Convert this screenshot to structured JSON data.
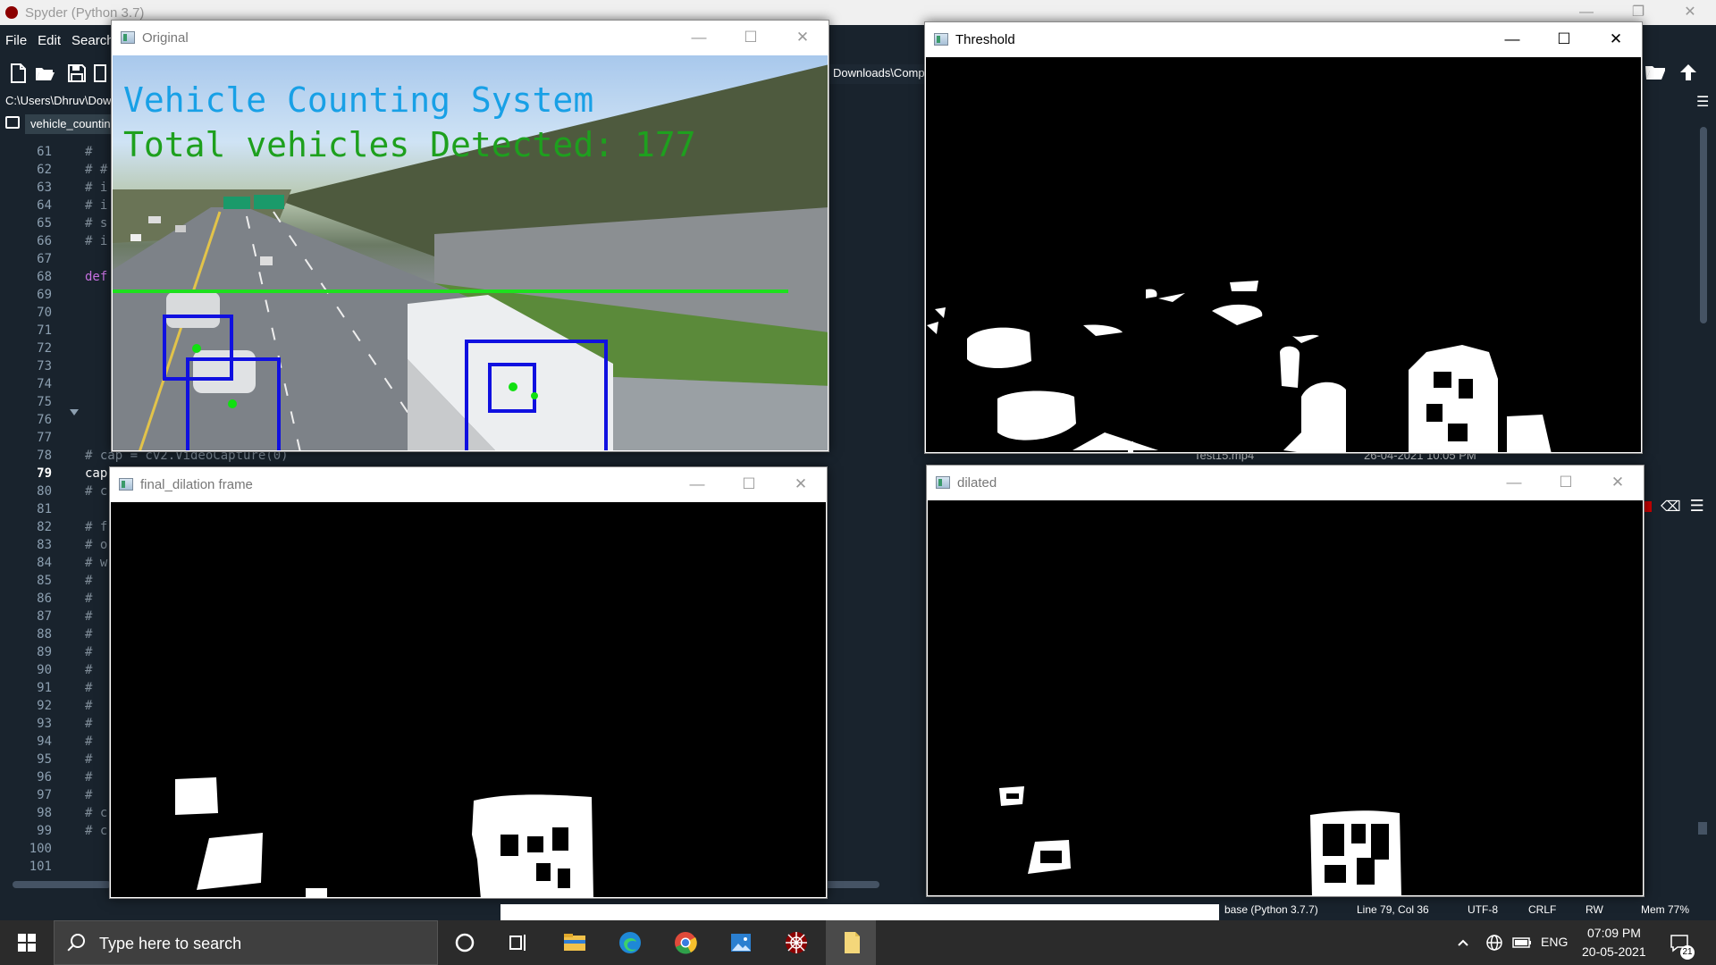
{
  "spyder": {
    "title": "Spyder (Python 3.7)",
    "window_buttons": [
      "—",
      "❐",
      "✕"
    ],
    "menu": [
      "File",
      "Edit",
      "Search"
    ],
    "path": "C:\\Users\\Dhruv\\Dow",
    "right_path": "Downloads\\Comp",
    "editor_tab": "vehicle_countin",
    "line_numbers": [
      "61",
      "62",
      "63",
      "64",
      "65",
      "66",
      "67",
      "68",
      "69",
      "70",
      "71",
      "72",
      "73",
      "74",
      "75",
      "76",
      "77",
      "78",
      "79",
      "80",
      "81",
      "82",
      "83",
      "84",
      "85",
      "86",
      "87",
      "88",
      "89",
      "90",
      "91",
      "92",
      "93",
      "94",
      "95",
      "96",
      "97",
      "98",
      "99",
      "100",
      "101"
    ],
    "active_line": "79",
    "code_61": "#",
    "code_62": "# #",
    "code_63": "# i",
    "code_64": "# i",
    "code_65": "# s",
    "code_66": "# i",
    "code_68": "def",
    "code_78": "# cap = cv2.VideoCapture(0)",
    "code_79": "cap",
    "code_80": "# c",
    "code_82": "# f",
    "code_83": "# o",
    "code_84": "# w",
    "code_hash": "#",
    "code_98": "# c",
    "code_99": "# c",
    "file_row": {
      "name": "Test15.mp4",
      "date": "26-04-2021 10:05 PM"
    },
    "status": {
      "env": "base (Python 3.7.7)",
      "position": "Line 79, Col 36",
      "encoding": "UTF-8",
      "eol": "CRLF",
      "mode": "RW",
      "mem": "Mem 77%"
    }
  },
  "windows": {
    "original": {
      "title": "Original",
      "overlay_title": "Vehicle Counting System",
      "overlay_count": "Total vehicles Detected: 177",
      "title_color": "#18a0e6",
      "count_color": "#1ea01e",
      "line_color": "#1ee01e",
      "box_color": "#1010e0"
    },
    "threshold": {
      "title": "Threshold"
    },
    "final_dilation": {
      "title": "final_dilation frame"
    },
    "dilated": {
      "title": "dilated"
    },
    "controls": {
      "minimize": "—",
      "maximize": "☐",
      "close": "✕"
    }
  },
  "taskbar": {
    "search_placeholder": "Type here to search",
    "icons": [
      "cortana-icon",
      "task-view-icon",
      "file-explorer-icon",
      "edge-icon",
      "chrome-icon",
      "photos-icon",
      "spyder-icon",
      "notepad-icon"
    ],
    "tray": {
      "language": "ENG",
      "time": "07:09 PM",
      "date": "20-05-2021",
      "notifications": "21"
    }
  }
}
